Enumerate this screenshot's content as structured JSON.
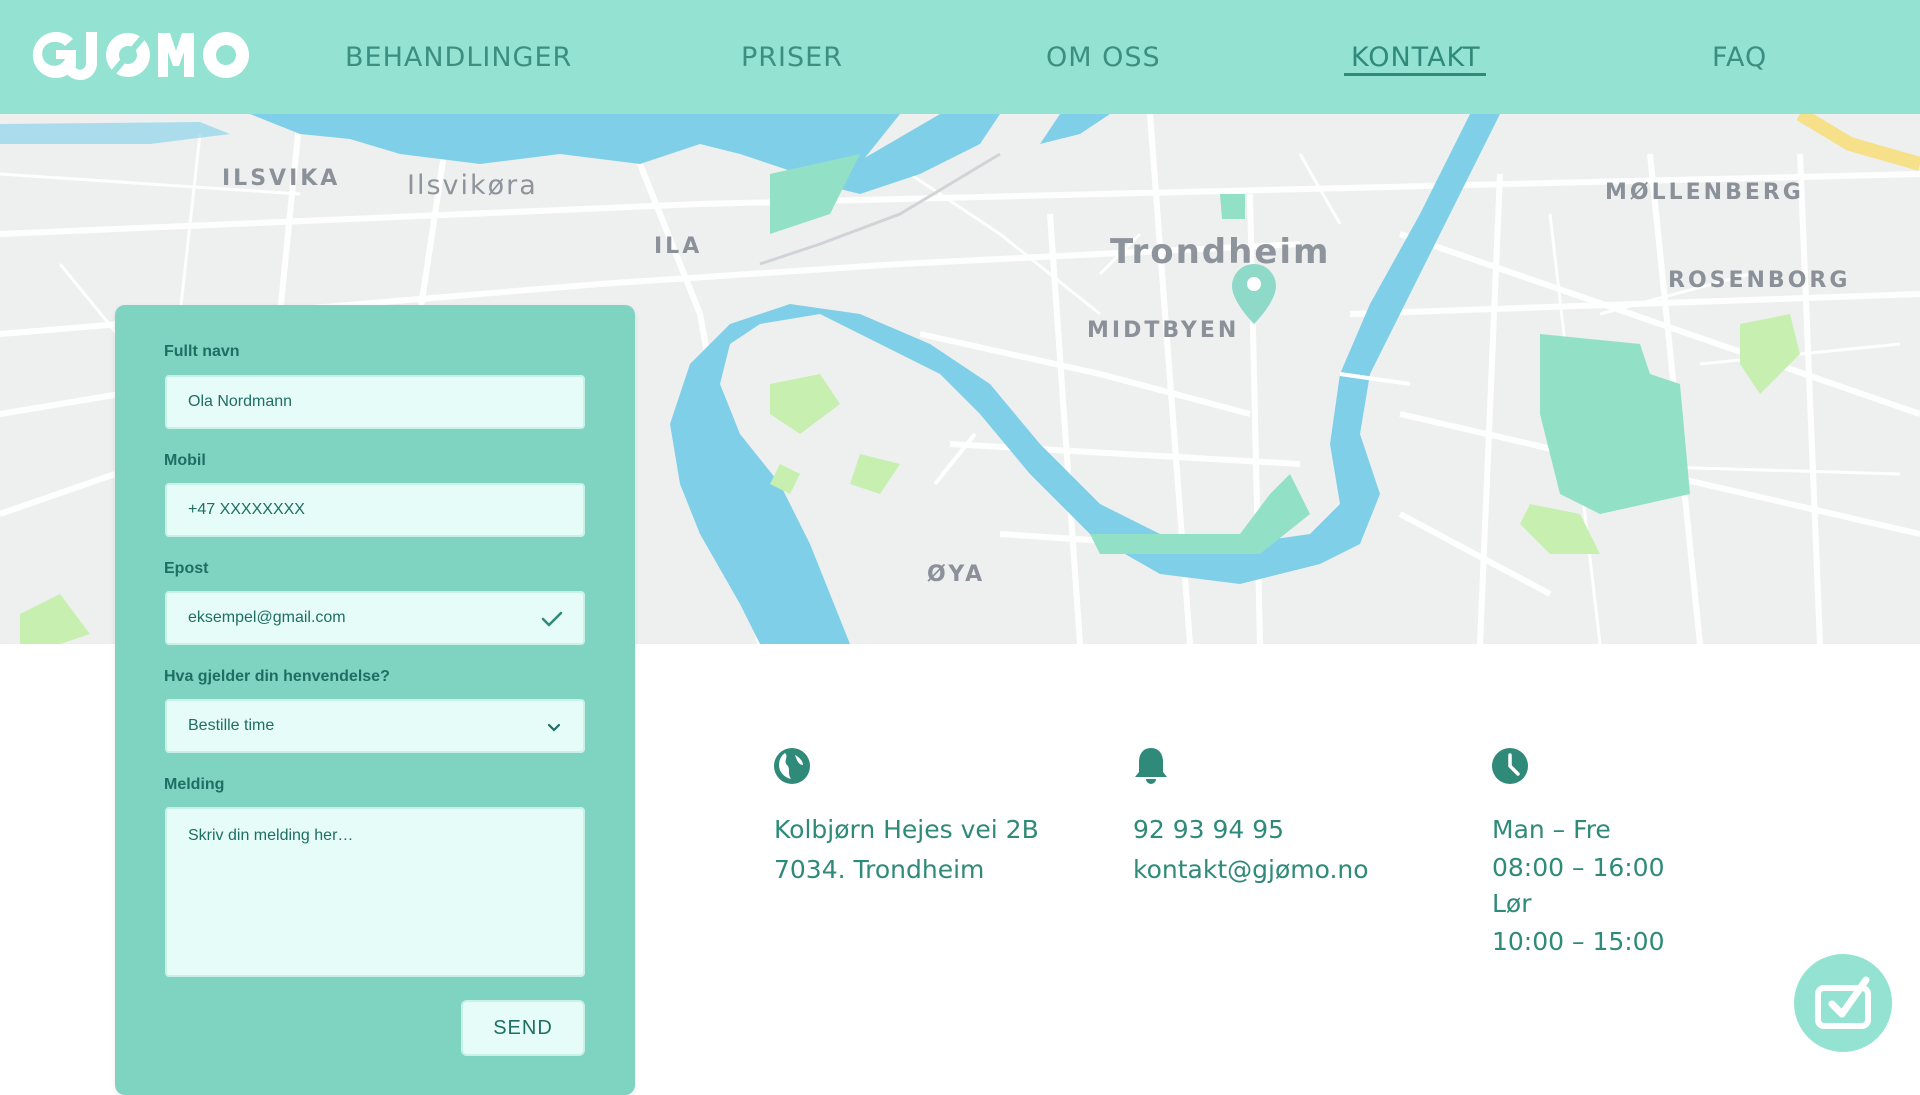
{
  "header": {
    "logo_text": "GJØMO",
    "nav": [
      {
        "label": "BEHANDLINGER"
      },
      {
        "label": "PRISER"
      },
      {
        "label": "OM OSS"
      },
      {
        "label": "KONTAKT",
        "active": true
      },
      {
        "label": "FAQ"
      }
    ]
  },
  "map": {
    "labels": {
      "ilsvika": "ILSVIKA",
      "ilsvikora": "Ilsvikøra",
      "ila": "ILA",
      "trondheim": "Trondheim",
      "midtbyen": "MIDTBYEN",
      "mollenberg": "MØLLENBERG",
      "rosenborg": "ROSENBORG",
      "oya": "ØYA"
    }
  },
  "form": {
    "name_label": "Fullt navn",
    "name_value": "Ola Nordmann",
    "mobile_label": "Mobil",
    "mobile_value": "+47 XXXXXXXX",
    "email_label": "Epost",
    "email_value": "eksempel@gmail.com",
    "topic_label": "Hva gjelder din henvendelse?",
    "topic_value": "Bestille time",
    "message_label": "Melding",
    "message_placeholder": "Skriv din melding her…",
    "send_label": "SEND"
  },
  "contact": {
    "address_line1": "Kolbjørn Hejes vei 2B",
    "address_line2": "7034. Trondheim",
    "phone": "92 93 94 95",
    "email": "kontakt@gjømo.no",
    "hours_weekday_label": "Man – Fre",
    "hours_weekday": "08:00 – 16:00",
    "hours_saturday_label": "Lør",
    "hours_saturday": "10:00 – 15:00"
  },
  "icons": {
    "address": "globe-icon",
    "phone": "bell-icon",
    "hours": "clock-icon",
    "badge": "checkbox-icon",
    "email_valid": "check-icon",
    "select": "chevron-down-icon",
    "map_pin": "map-pin-icon"
  },
  "colors": {
    "header_bg": "#94e2d1",
    "form_bg": "#7fd3c1",
    "accent": "#2f8a79",
    "field_bg": "#e6fcf8",
    "water": "#7fcfe9",
    "park": "#92e0c6"
  }
}
